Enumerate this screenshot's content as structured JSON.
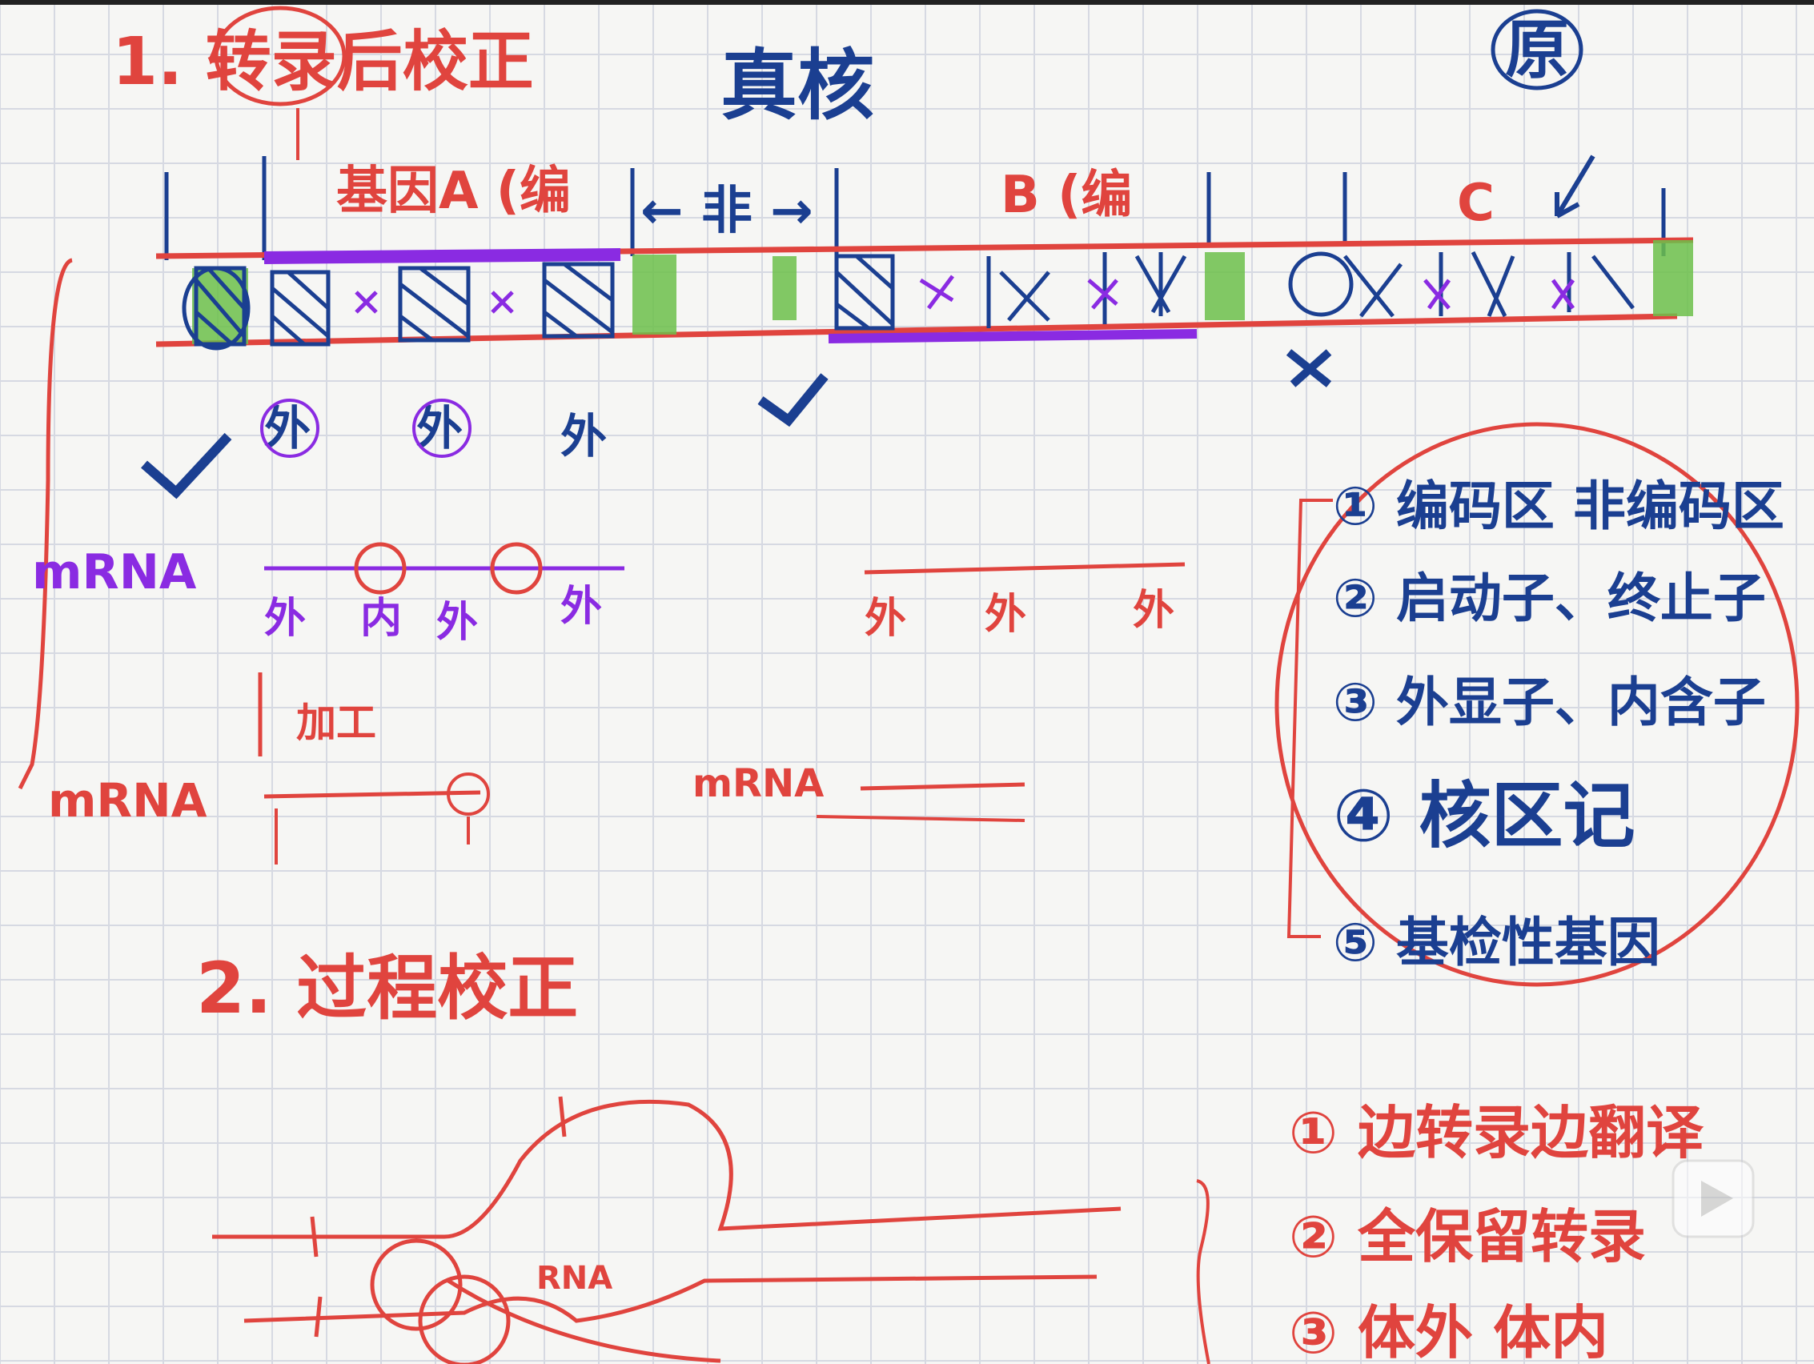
{
  "colors": {
    "grid": "#d6d9e2",
    "paper": "#f6f6f4",
    "red_ink": "#e0443e",
    "blue_ink": "#1b3f91",
    "purple_ink": "#8a2be2",
    "green_ink": "#6cbf4a"
  },
  "heading_1": "1. 转录后校正",
  "heading_center": "真核",
  "heading_right": "原",
  "gene_labels": {
    "a": "基因A (编",
    "noncoding": "← 非 →",
    "b": "B (编",
    "c": "C"
  },
  "exon_label": "外",
  "intron_label": "内",
  "labels": {
    "mrna_purple": "mRNA",
    "mrna_red": "mRNA",
    "mrna_small": "mRNA",
    "cap_tail": "加工"
  },
  "row_a_labels": [
    "外",
    "内",
    "外",
    "外"
  ],
  "row_b_labels": [
    "外",
    "外",
    "外"
  ],
  "right_list": [
    "① 编码区 非编码区",
    "② 启动子、终止子",
    "③ 外显子、内含子",
    "④ 核区记",
    "⑤ 基检性基因"
  ],
  "heading_2": "2. 过程校正",
  "right_list_2": [
    "① 边转录边翻译",
    "② 全保留转录",
    "③ 体外 体内"
  ],
  "rna_label": "RNA"
}
